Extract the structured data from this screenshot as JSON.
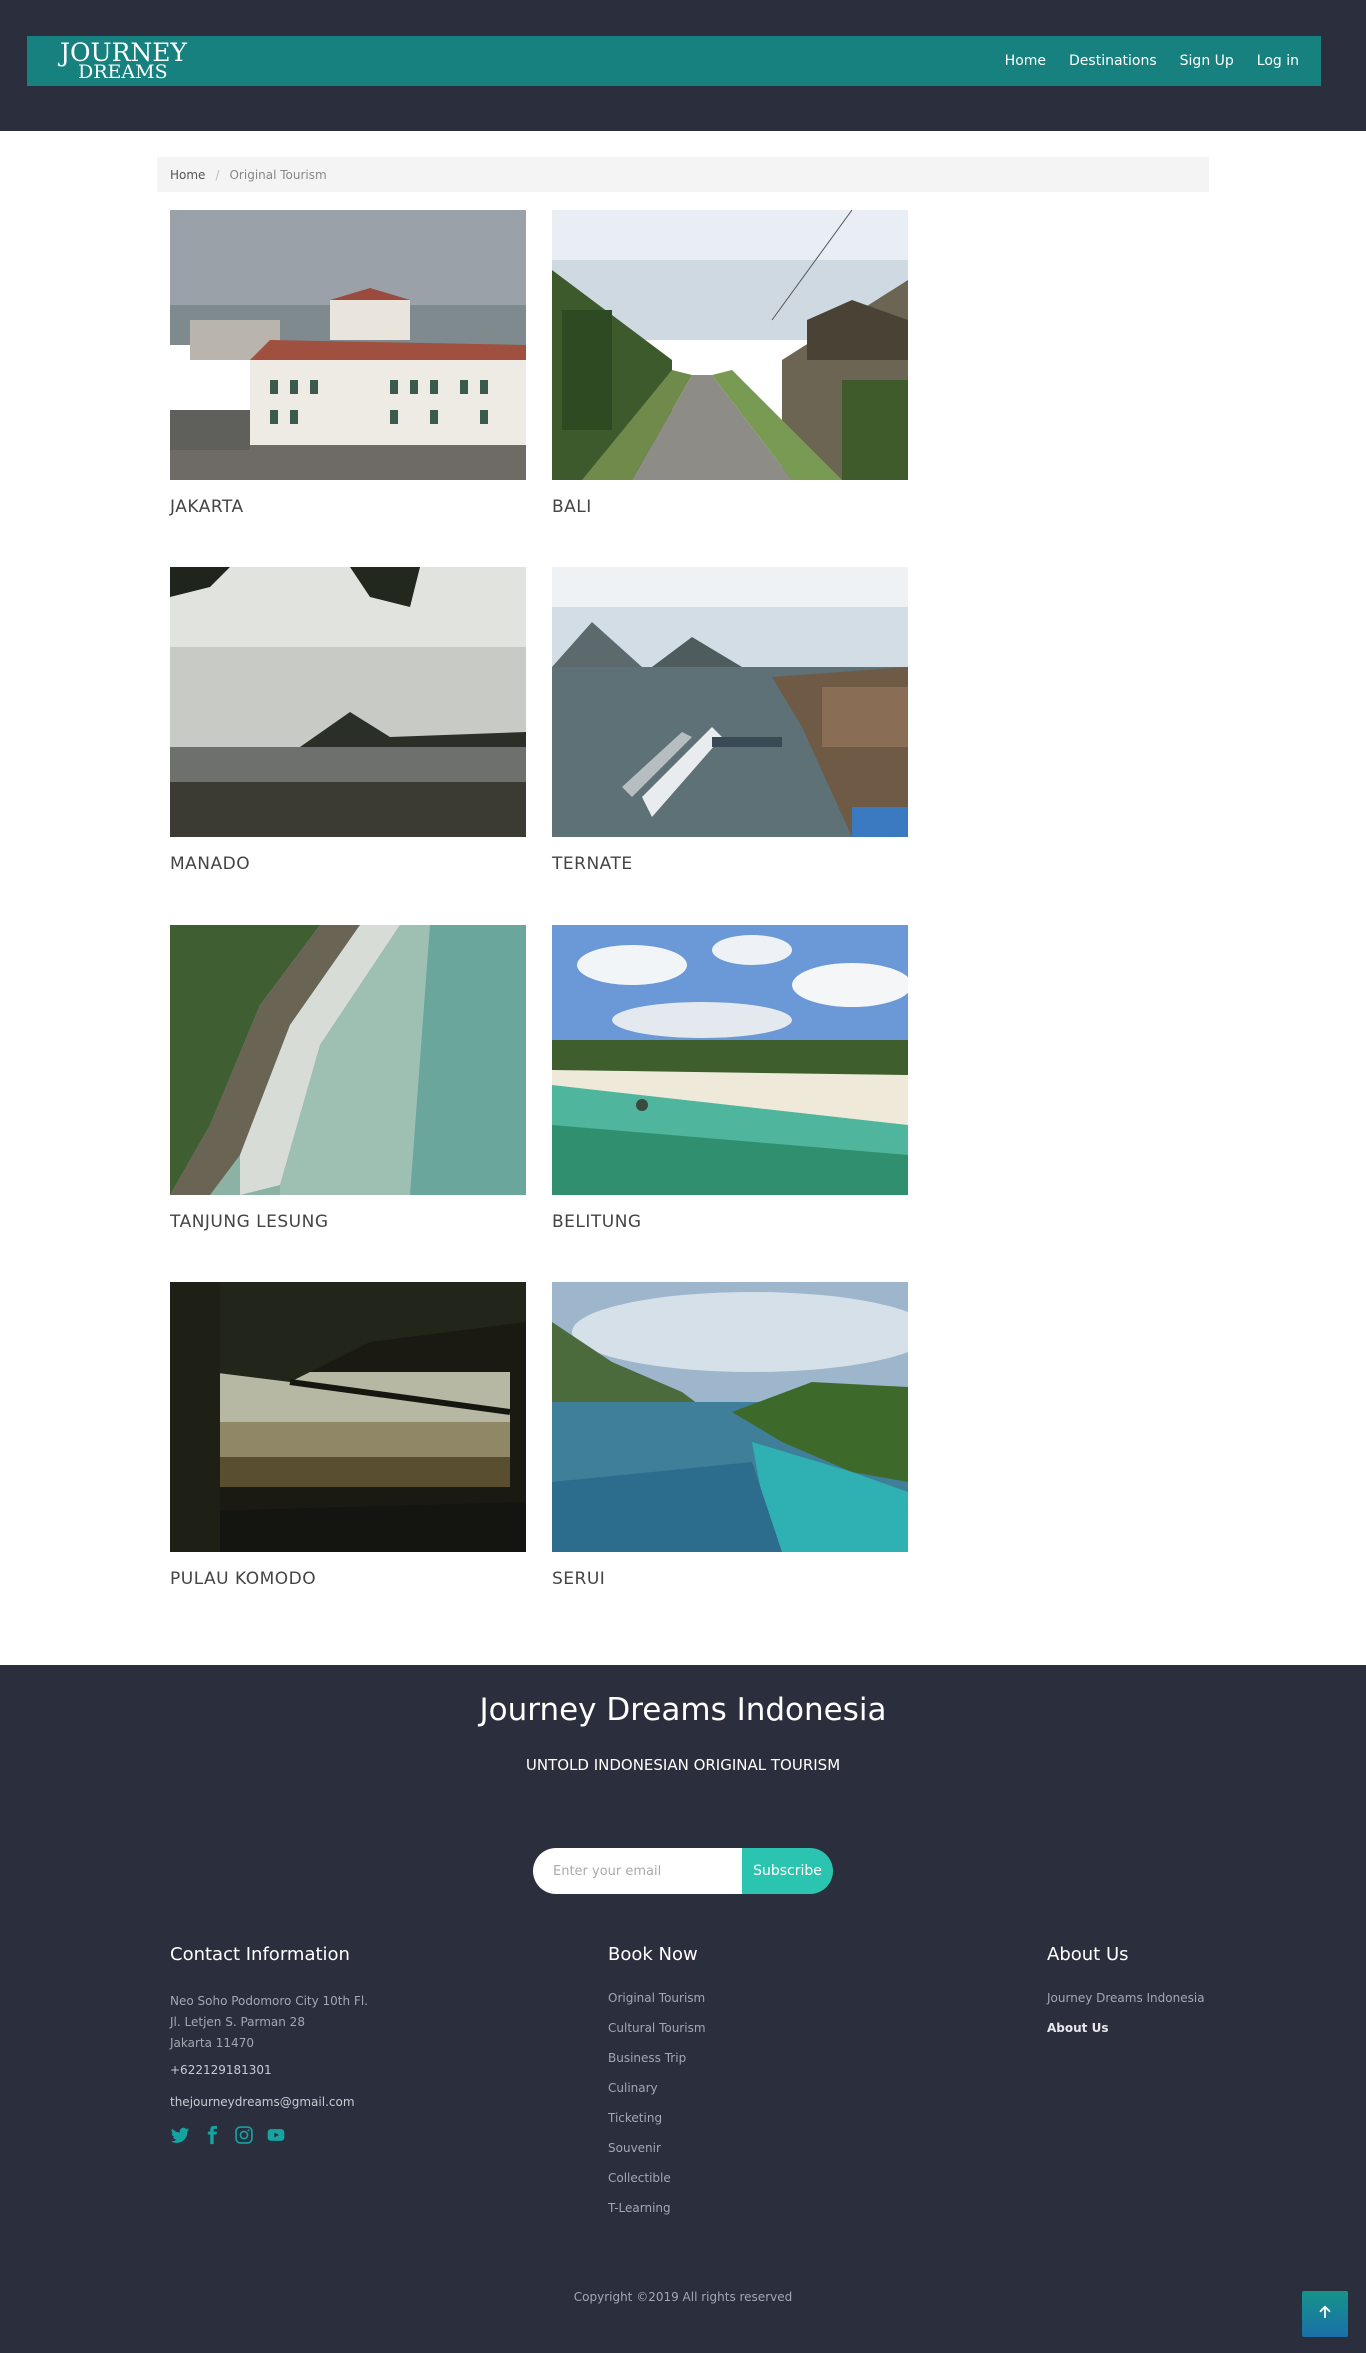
{
  "header": {
    "logo": {
      "line1": "JOURNEY",
      "line2": "DREAMS"
    },
    "nav": [
      "Home",
      "Destinations",
      "Sign Up",
      "Log in"
    ]
  },
  "breadcrumb": {
    "home": "Home",
    "current": "Original Tourism"
  },
  "destinations": [
    {
      "name": "JAKARTA",
      "photo": "photo-jakarta-colonial-building"
    },
    {
      "name": "BALI",
      "photo": "photo-bali-village-road"
    },
    {
      "name": "MANADO",
      "photo": "photo-manado-shore"
    },
    {
      "name": "TERNATE",
      "photo": "photo-ternate-harbour"
    },
    {
      "name": "TANJUNG LESUNG",
      "photo": "photo-tanjung-lesung-coast"
    },
    {
      "name": "BELITUNG",
      "photo": "photo-belitung-beach"
    },
    {
      "name": "PULAU KOMODO",
      "photo": "photo-pulau-komodo-trees"
    },
    {
      "name": "SERUI",
      "photo": "photo-serui-island"
    }
  ],
  "footer": {
    "title": "Journey Dreams Indonesia",
    "tagline": "UNTOLD INDONESIAN ORIGINAL TOURISM",
    "subscribe": {
      "placeholder": "Enter your email",
      "button": "Subscribe"
    },
    "contact": {
      "heading": "Contact Information",
      "address": [
        "Neo Soho Podomoro City 10th Fl.",
        "Jl. Letjen S. Parman 28",
        "Jakarta 11470"
      ],
      "phone": "+622129181301",
      "email": "thejourneydreams@gmail.com",
      "socials": [
        "twitter-icon",
        "facebook-icon",
        "instagram-icon",
        "youtube-icon"
      ]
    },
    "book": {
      "heading": "Book Now",
      "items": [
        "Original Tourism",
        "Cultural Tourism",
        "Business Trip",
        "Culinary",
        "Ticketing",
        "Souvenir",
        "Collectible",
        "T-Learning"
      ]
    },
    "about": {
      "heading": "About Us",
      "items": [
        "Journey Dreams Indonesia",
        "About Us"
      ]
    },
    "copyright": "Copyright ©2019 All rights reserved"
  },
  "colors": {
    "header_bg": "#2b2e3c",
    "nav_bg": "#16817e",
    "accent": "#2bc4b0"
  }
}
